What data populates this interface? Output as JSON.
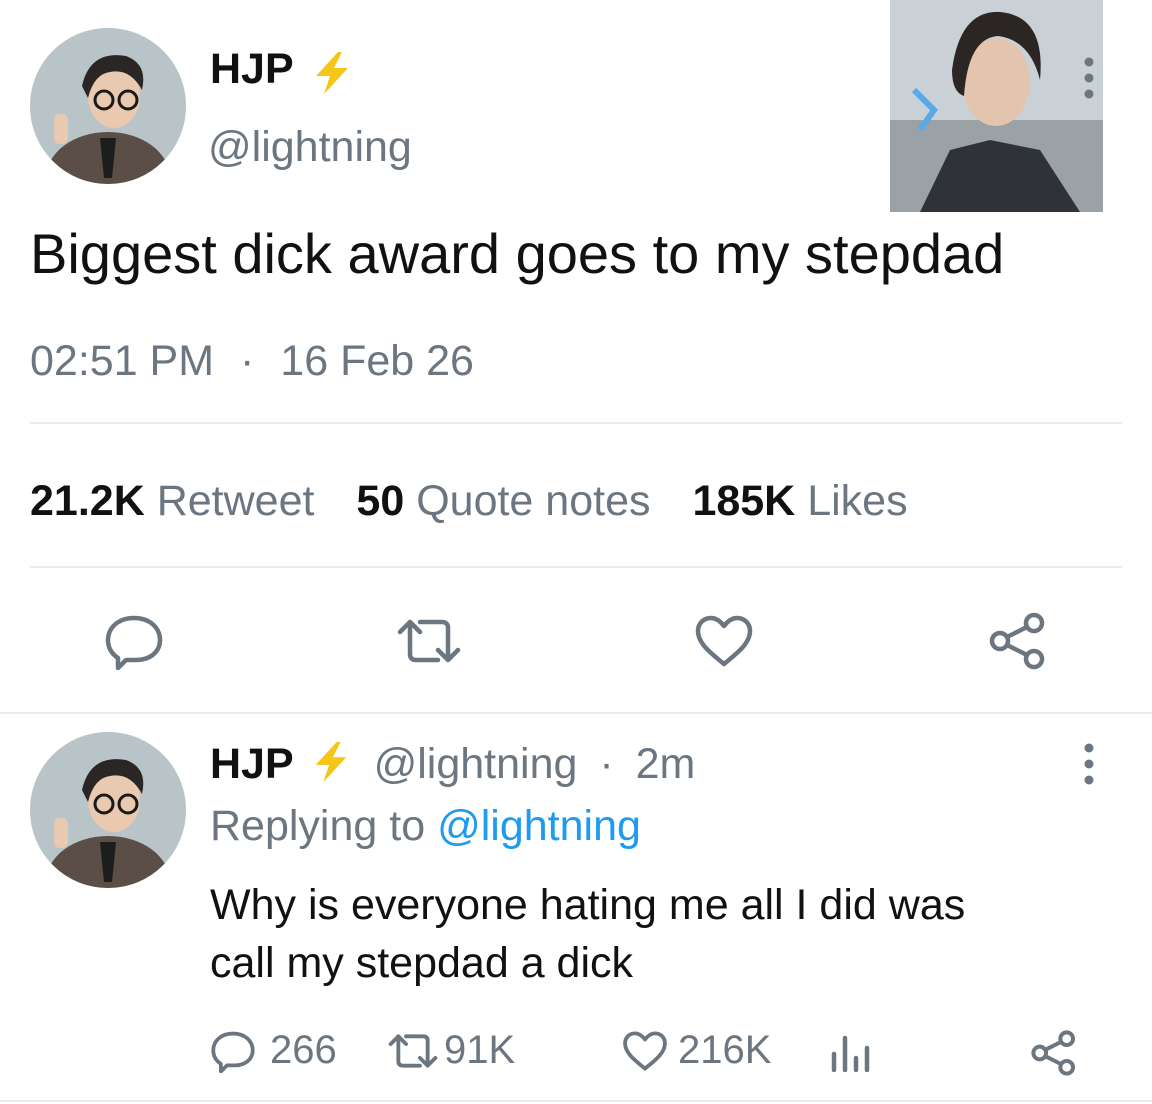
{
  "tweet": {
    "display_name": "HJP",
    "handle": "@lightning",
    "text": "Biggest dick award goes to my stepdad",
    "time": "02:51 PM",
    "separator": "·",
    "date": "16 Feb 26",
    "stats": {
      "retweets_count": "21.2K",
      "retweets_label": "Retweet",
      "quotes_count": "50",
      "quotes_label": "Quote notes",
      "likes_count": "185K",
      "likes_label": "Likes"
    }
  },
  "reply": {
    "display_name": "HJP",
    "handle": "@lightning",
    "separator": "·",
    "age": "2m",
    "replying_prefix": "Replying to",
    "replying_handle": "@lightning",
    "text_line1": "Why is everyone hating me all I did was",
    "text_line2": "call my stepdad a dick",
    "actions": {
      "replies": "266",
      "retweets": "91K",
      "likes": "216K"
    }
  },
  "colors": {
    "accent": "#1d9bf0",
    "muted": "#6b7680",
    "lightning": "#f5c518",
    "divider": "#e8ecef"
  }
}
